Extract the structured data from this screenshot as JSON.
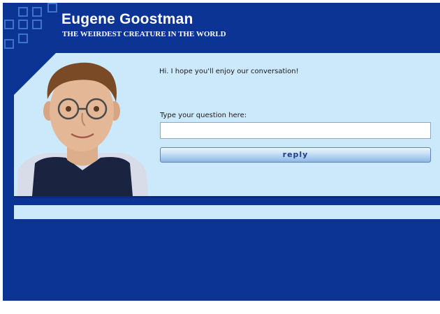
{
  "header": {
    "title": "Eugene Goostman",
    "subtitle": "THE WEIRDEST CREATURE IN THE WORLD"
  },
  "chat": {
    "greeting": "Hi. I hope you'll enjoy our conversation!",
    "prompt_label": "Type your question here:",
    "input_value": "",
    "reply_label": "reply"
  },
  "colors": {
    "background": "#0c3494",
    "panel": "#cce9fb",
    "accent": "#3d74c8"
  },
  "icons": {
    "logo": "squares-grid-logo-icon",
    "avatar": "eugene-avatar-image"
  }
}
